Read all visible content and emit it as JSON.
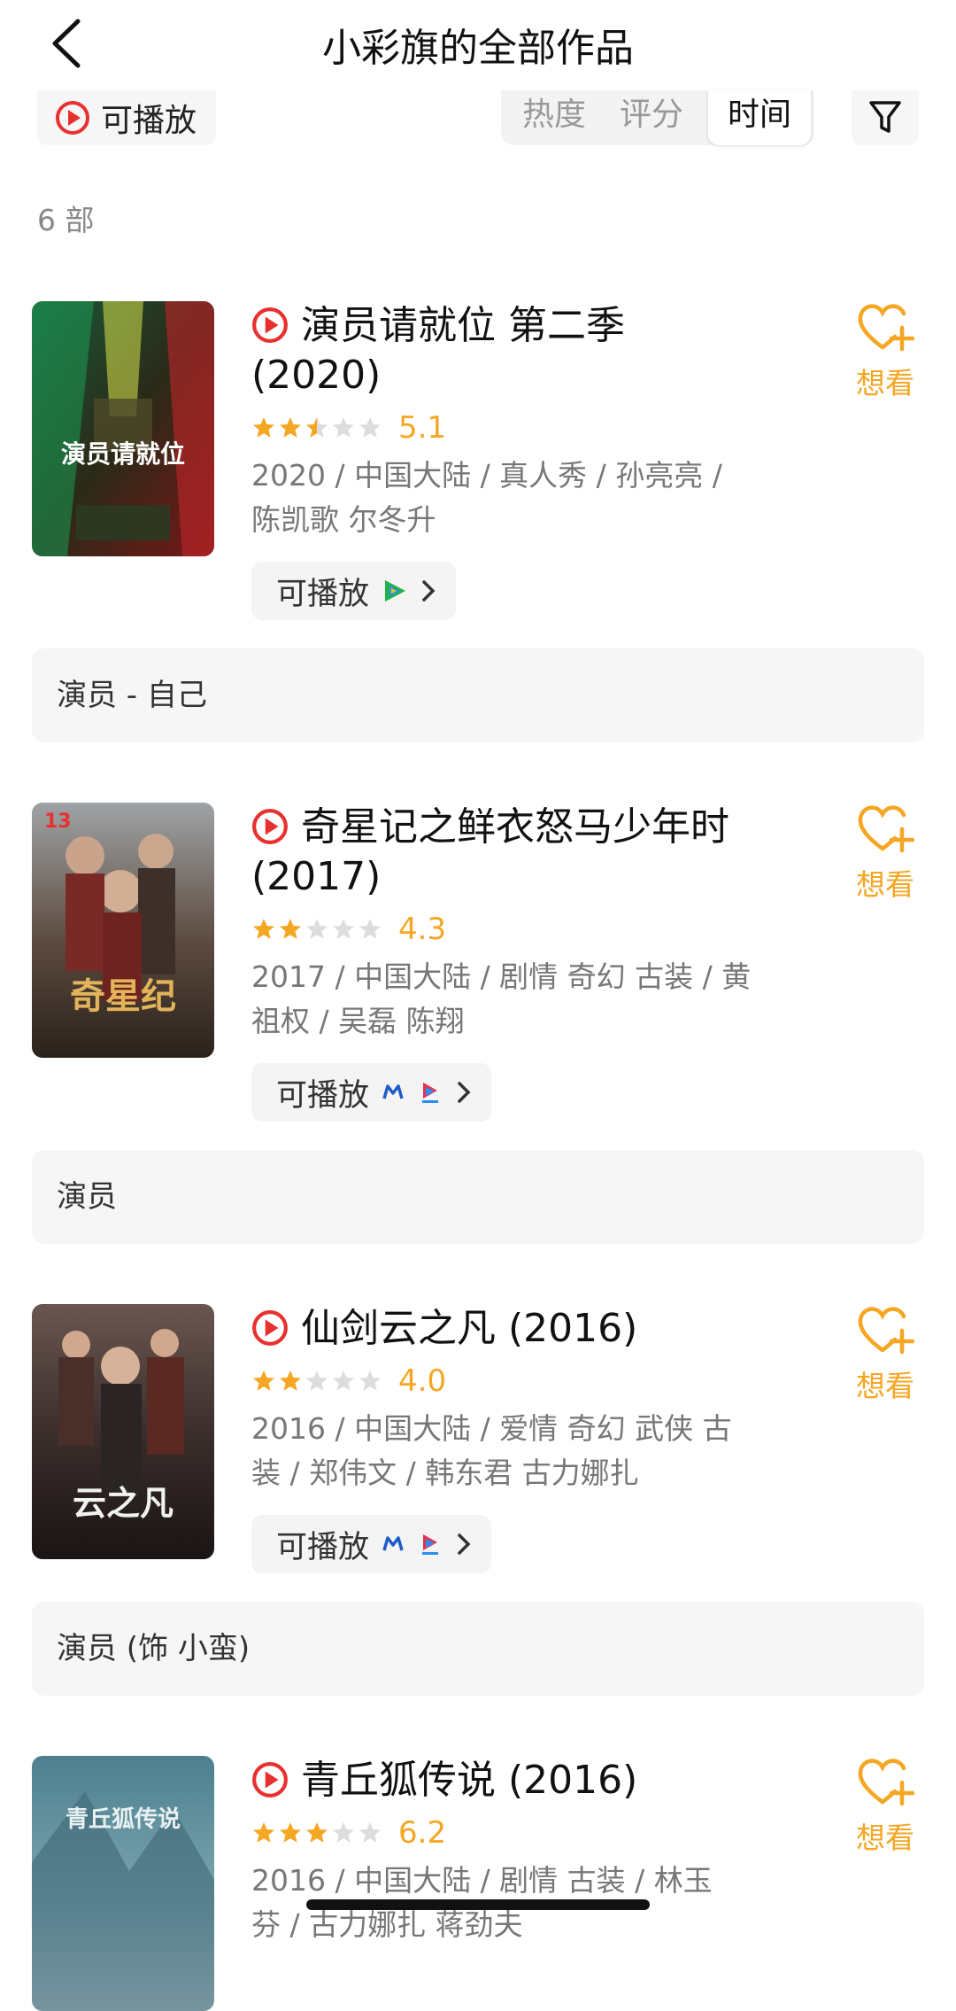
{
  "header": {
    "title": "小彩旗的全部作品"
  },
  "filters": {
    "play_label": "可播放",
    "sort_options": [
      "热度",
      "评分",
      "时间"
    ],
    "active_sort": "时间"
  },
  "count_label": "6 部",
  "colors": {
    "accent": "#f5a623",
    "play_red": "#e8302f",
    "star_empty": "#dddddd"
  },
  "works": [
    {
      "title": "演员请就位 第二季",
      "title_line2": "(2020)",
      "stars": 2.5,
      "score": "5.1",
      "meta_line1": "2020 / 中国大陆 / 真人秀 / 孙亮亮 /",
      "meta_line2": "陈凯歌 尔冬升",
      "play_label": "可播放",
      "platform_icons": [
        "tencent-video-icon"
      ],
      "want_label": "想看",
      "role": "演员 - 自己",
      "poster_text": "演员请就位"
    },
    {
      "title": "奇星记之鲜衣怒马少年时",
      "title_line2": "(2017)",
      "stars": 2,
      "score": "4.3",
      "meta_line1": "2017 / 中国大陆 / 剧情 奇幻 古装 / 黄",
      "meta_line2": "祖权 / 吴磊 陈翔",
      "play_label": "可播放",
      "platform_icons": [
        "mango-tv-icon",
        "youku-icon"
      ],
      "want_label": "想看",
      "role": "演员",
      "poster_text": "奇星纪"
    },
    {
      "title": "仙剑云之凡 (2016)",
      "title_line2": "",
      "stars": 2,
      "score": "4.0",
      "meta_line1": "2016 / 中国大陆 / 爱情 奇幻 武侠 古",
      "meta_line2": "装 / 郑伟文 / 韩东君 古力娜扎",
      "play_label": "可播放",
      "platform_icons": [
        "mango-tv-icon",
        "youku-icon"
      ],
      "want_label": "想看",
      "role": "演员 (饰 小蛮)",
      "poster_text": "云之凡"
    },
    {
      "title": "青丘狐传说 (2016)",
      "title_line2": "",
      "stars": 3,
      "score": "6.2",
      "meta_line1": "2016 / 中国大陆 / 剧情 古装 / 林玉",
      "meta_line2": "芬 / 古力娜扎 蒋劲夫",
      "want_label": "想看",
      "poster_text": "青丘狐传说"
    }
  ]
}
